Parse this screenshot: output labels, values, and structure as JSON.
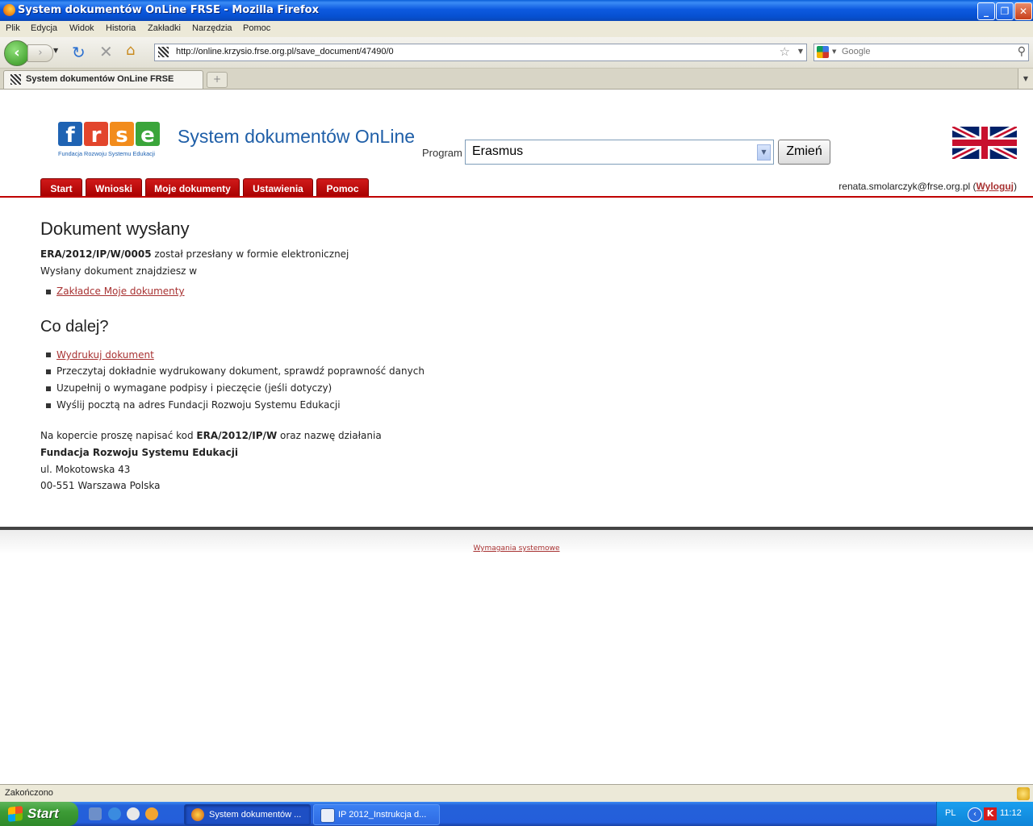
{
  "window": {
    "title": "System dokumentów OnLine FRSE - Mozilla Firefox",
    "controls": [
      "minimize-icon",
      "restore-icon",
      "close-icon"
    ]
  },
  "menu": [
    "Plik",
    "Edycja",
    "Widok",
    "Historia",
    "Zakładki",
    "Narzędzia",
    "Pomoc"
  ],
  "toolbar": {
    "url": "http://online.krzysio.frse.org.pl/save_document/47490/0",
    "search_placeholder": "Google"
  },
  "tab": {
    "title": "System dokumentów OnLine FRSE"
  },
  "site": {
    "logo_tagline": "Fundacja Rozwoju Systemu Edukacji",
    "title": "System dokumentów OnLine",
    "program_label": "Program",
    "program_value": "Erasmus",
    "change_button": "Zmień",
    "nav_tabs": [
      "Start",
      "Wnioski",
      "Moje dokumenty",
      "Ustawienia",
      "Pomoc"
    ],
    "user_email": "renata.smolarczyk@frse.org.pl",
    "logout_open": "(",
    "logout_label": "Wyloguj",
    "logout_close": ")",
    "accent_color": "#c00000"
  },
  "content": {
    "heading": "Dokument wysłany",
    "doc_code": "ERA/2012/IP/W/0005",
    "sent_text": " został przesłany w formie elektronicznej",
    "find_text": "Wysłany dokument znajdziesz w",
    "my_docs_link": "Zakładce Moje dokumenty",
    "next_heading": "Co dalej?",
    "steps": [
      "Wydrukuj dokument",
      "Przeczytaj dokładnie wydrukowany dokument, sprawdź poprawność danych",
      "Uzupełnij o wymagane podpisy i pieczęcie (jeśli dotyczy)",
      "Wyślij pocztą na adres Fundacji Rozwoju Systemu Edukacji"
    ],
    "envelope_prefix": "Na kopercie proszę napisać kod ",
    "envelope_code": "ERA/2012/IP/W",
    "envelope_suffix": " oraz nazwę działania",
    "address_name": "Fundacja Rozwoju Systemu Edukacji",
    "address_street": "ul. Mokotowska 43",
    "address_city": "00-551 Warszawa Polska",
    "footer_link": "Wymagania systemowe"
  },
  "statusbar": {
    "text": "Zakończono"
  },
  "taskbar": {
    "start": "Start",
    "tasks": [
      "System dokumentów ...",
      "IP 2012_Instrukcja d..."
    ],
    "language": "PL",
    "clock": "11:12"
  }
}
